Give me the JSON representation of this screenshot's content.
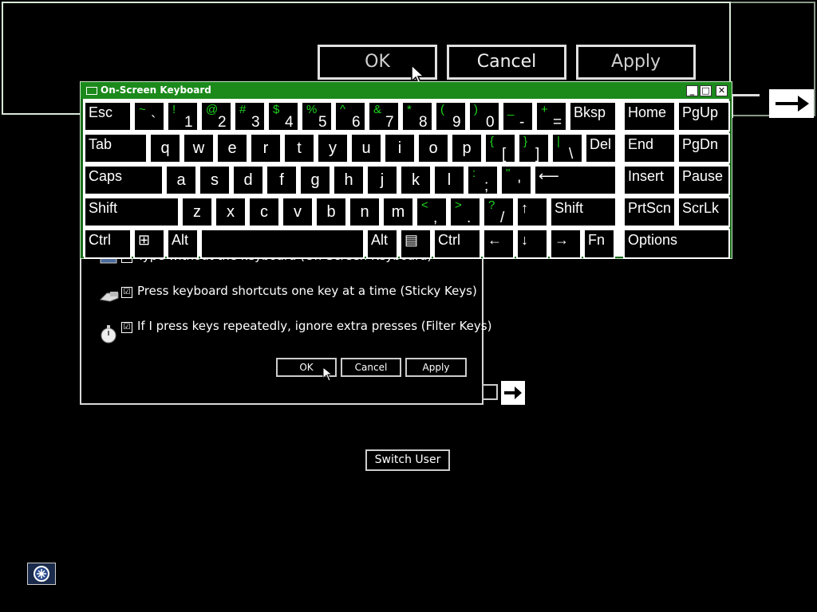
{
  "magnifier": {
    "ok_label": "OK",
    "cancel_label": "Cancel",
    "apply_label": "Apply"
  },
  "osk": {
    "title": "On-Screen Keyboard",
    "rows": [
      [
        {
          "id": "esc",
          "label": "Esc"
        },
        {
          "id": "backtick",
          "top": "~",
          "bottom": "`"
        },
        {
          "id": "1",
          "top": "!",
          "bottom": "1"
        },
        {
          "id": "2",
          "top": "@",
          "bottom": "2"
        },
        {
          "id": "3",
          "top": "#",
          "bottom": "3"
        },
        {
          "id": "4",
          "top": "$",
          "bottom": "4"
        },
        {
          "id": "5",
          "top": "%",
          "bottom": "5"
        },
        {
          "id": "6",
          "top": "^",
          "bottom": "6"
        },
        {
          "id": "7",
          "top": "&",
          "bottom": "7"
        },
        {
          "id": "8",
          "top": "*",
          "bottom": "8"
        },
        {
          "id": "9",
          "top": "(",
          "bottom": "9"
        },
        {
          "id": "0",
          "top": ")",
          "bottom": "0"
        },
        {
          "id": "minus",
          "top": "_",
          "bottom": "-"
        },
        {
          "id": "equals",
          "top": "+",
          "bottom": "="
        },
        {
          "id": "bksp",
          "label": "Bksp"
        },
        {
          "id": "home",
          "label": "Home"
        },
        {
          "id": "pgup",
          "label": "PgUp"
        }
      ],
      [
        {
          "id": "tab",
          "label": "Tab"
        },
        {
          "id": "q",
          "label": "q"
        },
        {
          "id": "w",
          "label": "w"
        },
        {
          "id": "e",
          "label": "e"
        },
        {
          "id": "r",
          "label": "r"
        },
        {
          "id": "t",
          "label": "t"
        },
        {
          "id": "y",
          "label": "y"
        },
        {
          "id": "u",
          "label": "u"
        },
        {
          "id": "i",
          "label": "i"
        },
        {
          "id": "o",
          "label": "o"
        },
        {
          "id": "p",
          "label": "p"
        },
        {
          "id": "lbracket",
          "top": "{",
          "bottom": "["
        },
        {
          "id": "rbracket",
          "top": "}",
          "bottom": "]"
        },
        {
          "id": "backslash",
          "top": "|",
          "bottom": "\\"
        },
        {
          "id": "del",
          "label": "Del"
        },
        {
          "id": "end",
          "label": "End"
        },
        {
          "id": "pgdn",
          "label": "PgDn"
        }
      ],
      [
        {
          "id": "caps",
          "label": "Caps"
        },
        {
          "id": "a",
          "label": "a"
        },
        {
          "id": "s",
          "label": "s"
        },
        {
          "id": "d",
          "label": "d"
        },
        {
          "id": "f",
          "label": "f"
        },
        {
          "id": "g",
          "label": "g"
        },
        {
          "id": "h",
          "label": "h"
        },
        {
          "id": "j",
          "label": "j"
        },
        {
          "id": "k",
          "label": "k"
        },
        {
          "id": "l",
          "label": "l"
        },
        {
          "id": "semicolon",
          "top": ":",
          "bottom": ";"
        },
        {
          "id": "quote",
          "top": "\"",
          "bottom": "'"
        },
        {
          "id": "enter",
          "label": "⟵"
        },
        {
          "id": "insert",
          "label": "Insert"
        },
        {
          "id": "pause",
          "label": "Pause"
        }
      ],
      [
        {
          "id": "lshift",
          "label": "Shift"
        },
        {
          "id": "z",
          "label": "z"
        },
        {
          "id": "x",
          "label": "x"
        },
        {
          "id": "c",
          "label": "c"
        },
        {
          "id": "v",
          "label": "v"
        },
        {
          "id": "b",
          "label": "b"
        },
        {
          "id": "n",
          "label": "n"
        },
        {
          "id": "m",
          "label": "m"
        },
        {
          "id": "comma",
          "top": "<",
          "bottom": ","
        },
        {
          "id": "period",
          "top": ">",
          "bottom": "."
        },
        {
          "id": "slash",
          "top": "?",
          "bottom": "/"
        },
        {
          "id": "up",
          "label": "↑"
        },
        {
          "id": "rshift",
          "label": "Shift"
        },
        {
          "id": "prtscn",
          "label": "PrtScn"
        },
        {
          "id": "scrlk",
          "label": "ScrLk"
        }
      ],
      [
        {
          "id": "lctrl",
          "label": "Ctrl"
        },
        {
          "id": "win",
          "label": "⊞"
        },
        {
          "id": "lalt",
          "label": "Alt"
        },
        {
          "id": "space",
          "label": ""
        },
        {
          "id": "ralt",
          "label": "Alt"
        },
        {
          "id": "menu",
          "label": "▤"
        },
        {
          "id": "rctrl",
          "label": "Ctrl"
        },
        {
          "id": "left",
          "label": "←"
        },
        {
          "id": "down",
          "label": "↓"
        },
        {
          "id": "right",
          "label": "→"
        },
        {
          "id": "fn",
          "label": "Fn"
        },
        {
          "id": "options",
          "label": "Options"
        }
      ]
    ]
  },
  "ease": {
    "options": [
      {
        "label": "Type without the keyboard (On-Screen Keyboard)",
        "checked": true,
        "icon": "keyboard-icon"
      },
      {
        "label": "Press keyboard shortcuts one key at a time (Sticky Keys)",
        "checked": true,
        "icon": "sticky-keys-icon"
      },
      {
        "label": "If I press keys repeatedly, ignore extra presses (Filter Keys)",
        "checked": true,
        "icon": "stopwatch-icon"
      }
    ],
    "ok_label": "OK",
    "cancel_label": "Cancel",
    "apply_label": "Apply"
  },
  "switch_user_label": "Switch User",
  "check_mark": "☑",
  "colors": {
    "keyboard_title_bar": "#1b8a1b",
    "shifted_glyph": "#1ed81e"
  }
}
